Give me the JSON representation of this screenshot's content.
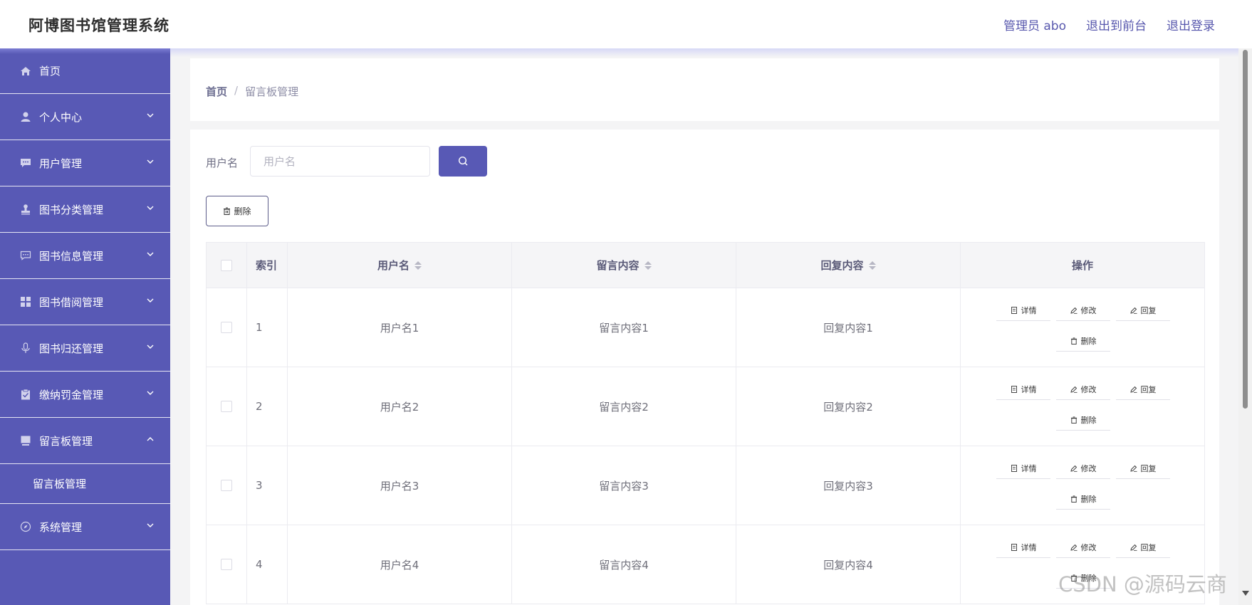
{
  "header": {
    "app_title": "阿博图书馆管理系统",
    "admin_label": "管理员 abo",
    "front_label": "退出到前台",
    "logout_label": "退出登录"
  },
  "sidebar": {
    "items": [
      {
        "label": "首页",
        "icon": "home-icon"
      },
      {
        "label": "个人中心",
        "icon": "user-icon"
      },
      {
        "label": "用户管理",
        "icon": "chat-bubble-icon"
      },
      {
        "label": "图书分类管理",
        "icon": "stamp-icon"
      },
      {
        "label": "图书信息管理",
        "icon": "message-icon"
      },
      {
        "label": "图书借阅管理",
        "icon": "grid-icon"
      },
      {
        "label": "图书归还管理",
        "icon": "microphone-icon"
      },
      {
        "label": "缴纳罚金管理",
        "icon": "clipboard-icon"
      },
      {
        "label": "留言板管理",
        "icon": "monitor-icon"
      },
      {
        "label": "系统管理",
        "icon": "compass-icon"
      }
    ],
    "sub_item": "留言板管理"
  },
  "breadcrumb": {
    "home": "首页",
    "separator": "/",
    "current": "留言板管理"
  },
  "search": {
    "label": "用户名",
    "placeholder": "用户名"
  },
  "toolbar": {
    "delete_label": "删除"
  },
  "table": {
    "headers": {
      "index": "索引",
      "username": "用户名",
      "message": "留言内容",
      "reply": "回复内容",
      "ops": "操作"
    },
    "rows": [
      {
        "index": "1",
        "username": "用户名1",
        "message": "留言内容1",
        "reply": "回复内容1"
      },
      {
        "index": "2",
        "username": "用户名2",
        "message": "留言内容2",
        "reply": "回复内容2"
      },
      {
        "index": "3",
        "username": "用户名3",
        "message": "留言内容3",
        "reply": "回复内容3"
      },
      {
        "index": "4",
        "username": "用户名4",
        "message": "留言内容4",
        "reply": "回复内容4"
      }
    ],
    "actions": {
      "detail": "详情",
      "edit": "修改",
      "reply": "回复",
      "delete": "删除"
    }
  },
  "watermark": "CSDN @源码云商",
  "colors": {
    "accent": "#5859b5",
    "link": "#5757ad"
  }
}
